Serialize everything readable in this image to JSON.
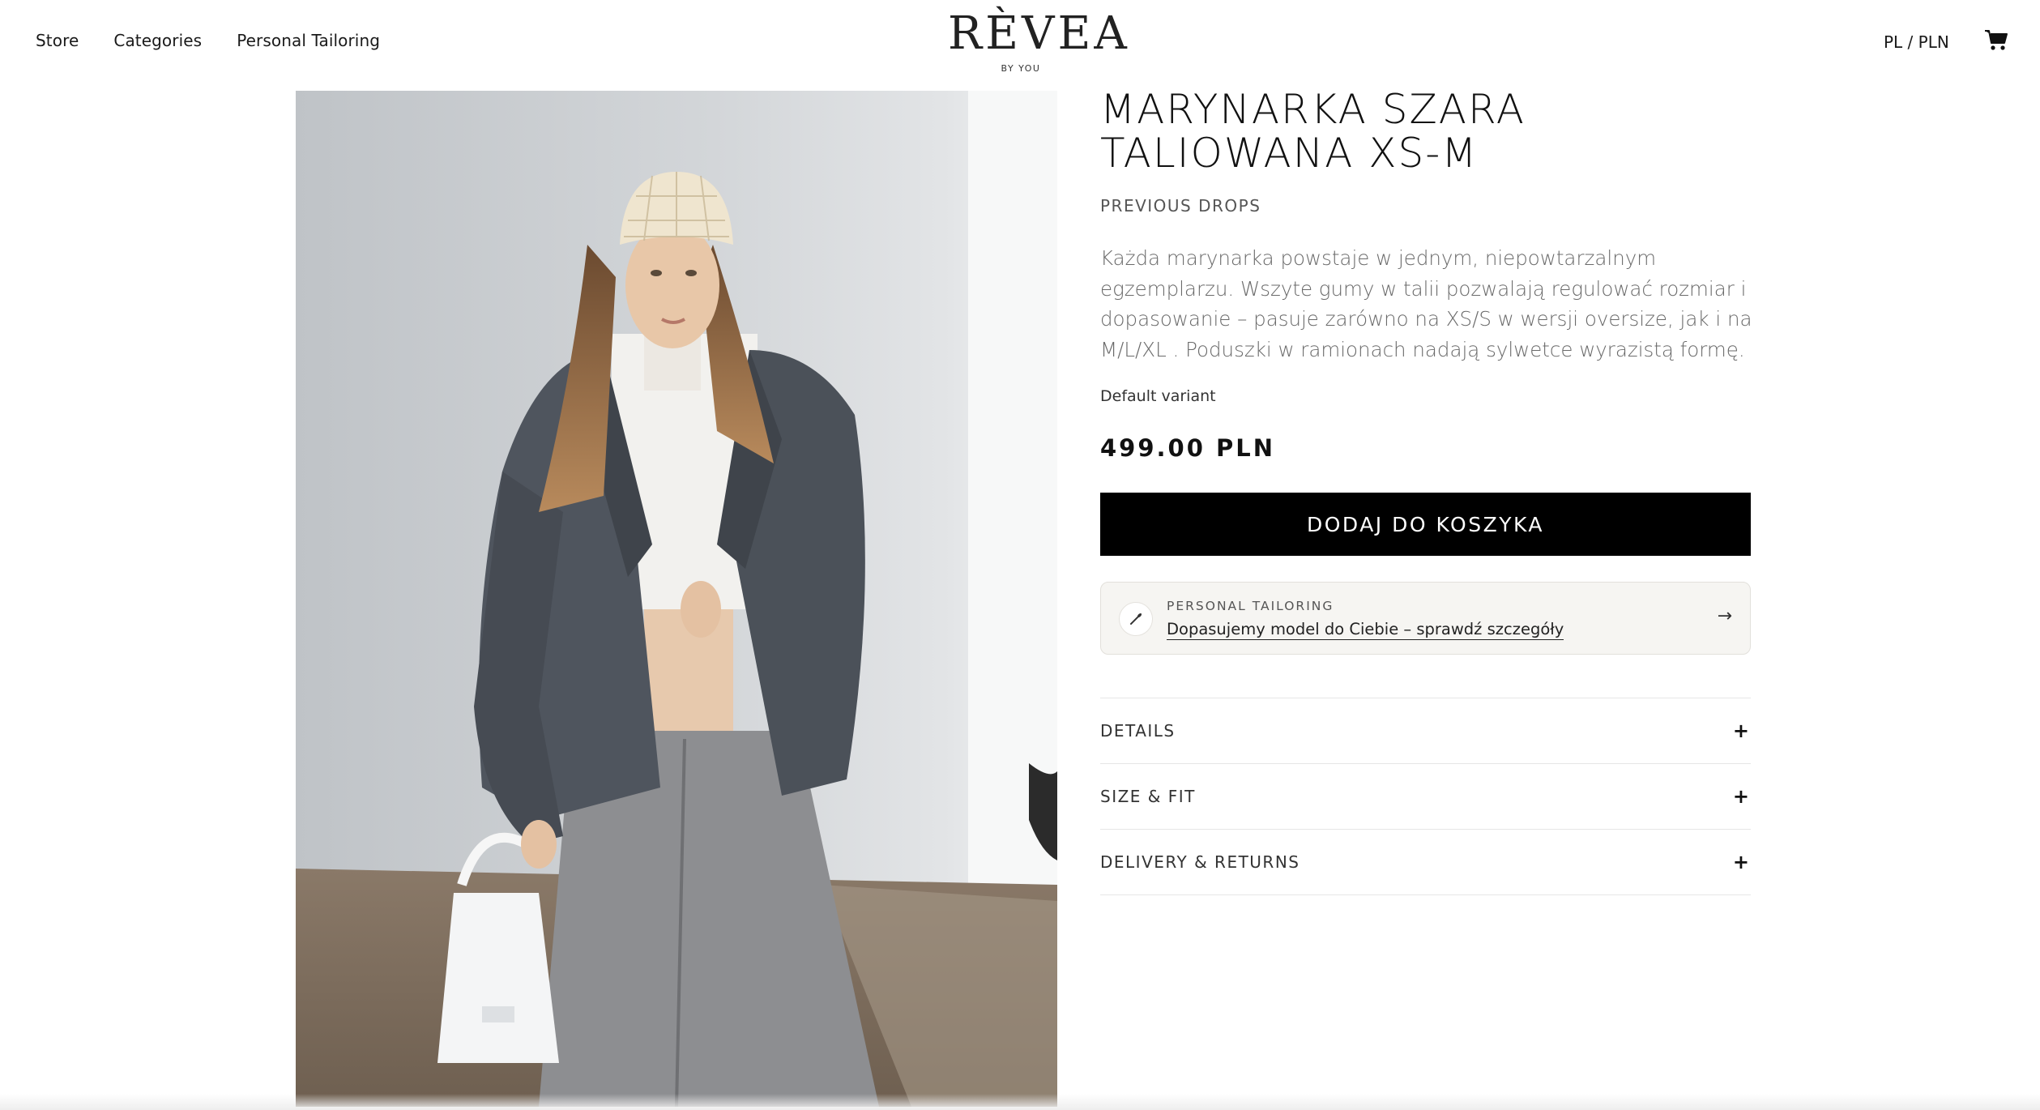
{
  "nav": {
    "items": [
      "Store",
      "Categories",
      "Personal Tailoring"
    ]
  },
  "brand": {
    "logo_text": "RÈVEA",
    "tagline": "BY YOU"
  },
  "header": {
    "locale": "PL / PLN",
    "cart_icon": "cart-icon"
  },
  "product": {
    "title_line1": "MARYNARKA SZARA",
    "title_line2": "TALIOWANA XS-M",
    "collection": "PREVIOUS DROPS",
    "description": "Każda marynarka powstaje w jednym, niepowtarzalnym egzemplarzu. Wszyte gumy w talii pozwalają regulować rozmiar i dopasowanie – pasuje zarówno na XS/S w wersji oversize, jak i na M/L/XL . Poduszki w ramionach nadają sylwetce wyrazistą formę.",
    "variant": "Default variant",
    "price": "499.00 PLN",
    "add_to_cart": "DODAJ DO KOSZYKA"
  },
  "tailoring": {
    "kicker": "PERSONAL TAILORING",
    "link": "Dopasujemy model do Ciebie – sprawdź szczegóły",
    "icon": "needle-icon",
    "arrow": "→"
  },
  "accordion": [
    {
      "label": "DETAILS",
      "icon": "+"
    },
    {
      "label": "SIZE & FIT",
      "icon": "+"
    },
    {
      "label": "DELIVERY & RETURNS",
      "icon": "+"
    }
  ],
  "colors": {
    "button_bg": "#000000",
    "panel_bg": "#f6f5f2",
    "text_muted": "#6a6a6a"
  }
}
